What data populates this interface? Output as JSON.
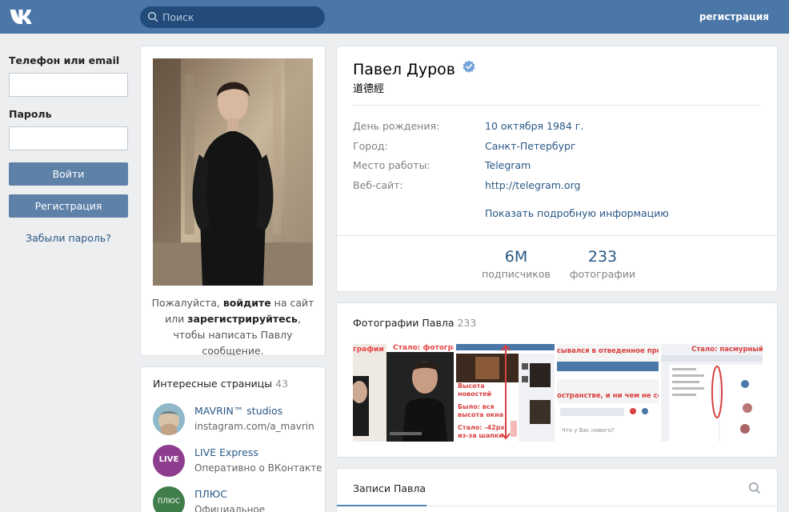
{
  "header": {
    "logo": "vk-logo-icon",
    "search_placeholder": "Поиск",
    "register_label": "регистрация"
  },
  "login": {
    "phone_label": "Телефон или email",
    "password_label": "Пароль",
    "login_button": "Войти",
    "register_button": "Регистрация",
    "forgot_link": "Забыли пароль?"
  },
  "photo_card": {
    "message_pre": "Пожалуйста, ",
    "message_login": "войдите",
    "message_mid": " на сайт или ",
    "message_register": "зарегистрируйтесь",
    "message_post": ", чтобы написать Павлу сообщение."
  },
  "interesting": {
    "title": "Интересные страницы",
    "count": "43",
    "items": [
      {
        "name": "MAVRIN™ studios",
        "sub": "instagram.com/a_mavrin"
      },
      {
        "name": "LIVE Express",
        "sub": "Оперативно о ВКонтакте",
        "ava_text": "LIVE"
      },
      {
        "name": "ПЛЮС",
        "sub": "Официальное",
        "ava_text": "ПЛЮС"
      }
    ]
  },
  "profile": {
    "name": "Павел Дуров",
    "status": "道德經",
    "info": [
      {
        "key": "День рождения:",
        "value": "10 октября 1984 г."
      },
      {
        "key": "Город:",
        "value": "Санкт-Петербург"
      },
      {
        "key": "Место работы:",
        "value": "Telegram"
      },
      {
        "key": "Веб-сайт:",
        "value": "http://telegram.org"
      }
    ],
    "more_link": "Показать подробную информацию",
    "counters": [
      {
        "num": "6M",
        "label": "подписчиков"
      },
      {
        "num": "233",
        "label": "фотографии"
      }
    ]
  },
  "photos": {
    "title": "Фотографии Павла",
    "count": "233",
    "thumb_texts": [
      {
        "t1": "графии"
      },
      {
        "t1": "Стало: фотография"
      },
      {
        "t1": "Высота новостей",
        "t2": "Было: вся высота окна",
        "t3": "Стало: -42px из-за шапки"
      },
      {
        "t1": "сывался в отведенное простра",
        "t2": "остранстве, и ни чем не сочета",
        "t3": "Что у Вас нового?"
      },
      {
        "t1": "Стало: пасмурный серый"
      }
    ]
  },
  "posts": {
    "tab_label": "Записи Павла"
  },
  "colors": {
    "header": "#4a76a8",
    "link": "#2a5885",
    "button": "#5e81a8",
    "background": "#edeef0"
  }
}
